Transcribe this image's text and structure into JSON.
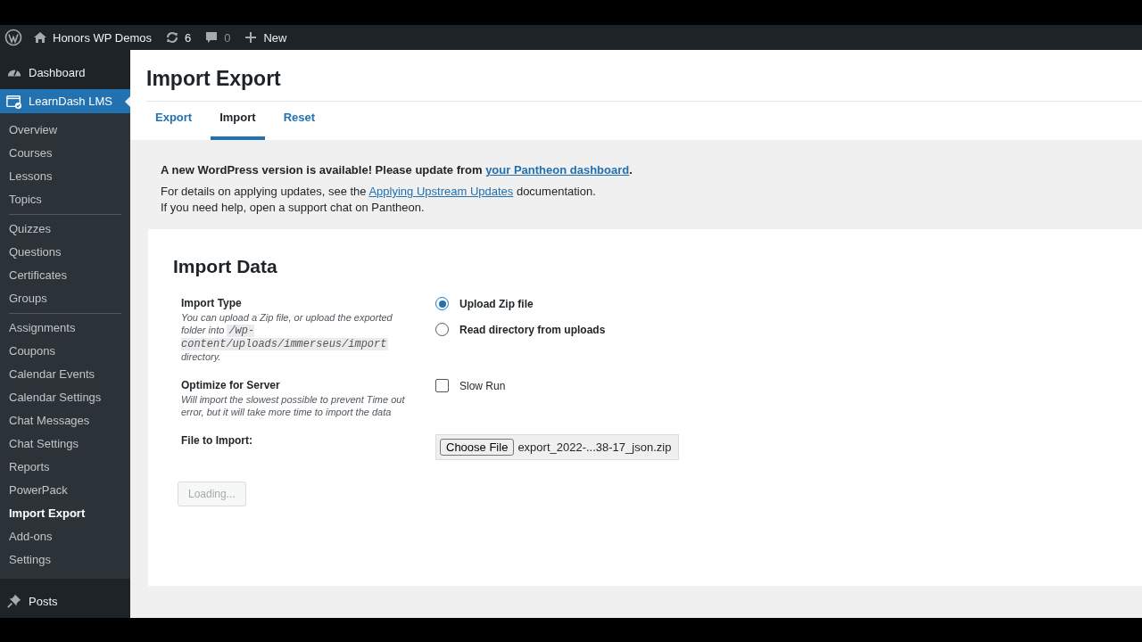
{
  "admin_bar": {
    "site_name": "Honors WP Demos",
    "updates_count": "6",
    "comments_count": "0",
    "new_label": "New"
  },
  "sidebar": {
    "top_items": [
      {
        "label": "Dashboard",
        "selected": false
      },
      {
        "label": "LearnDash LMS",
        "selected": true
      }
    ],
    "submenu_groups": [
      [
        {
          "label": "Overview",
          "selected": false
        },
        {
          "label": "Courses",
          "selected": false
        },
        {
          "label": "Lessons",
          "selected": false
        },
        {
          "label": "Topics",
          "selected": false
        }
      ],
      [
        {
          "label": "Quizzes",
          "selected": false
        },
        {
          "label": "Questions",
          "selected": false
        },
        {
          "label": "Certificates",
          "selected": false
        },
        {
          "label": "Groups",
          "selected": false
        }
      ],
      [
        {
          "label": "Assignments",
          "selected": false
        },
        {
          "label": "Coupons",
          "selected": false
        },
        {
          "label": "Calendar Events",
          "selected": false
        },
        {
          "label": "Calendar Settings",
          "selected": false
        },
        {
          "label": "Chat Messages",
          "selected": false
        },
        {
          "label": "Chat Settings",
          "selected": false
        },
        {
          "label": "Reports",
          "selected": false
        },
        {
          "label": "PowerPack",
          "selected": false
        },
        {
          "label": "Import Export",
          "selected": true
        },
        {
          "label": "Add-ons",
          "selected": false
        },
        {
          "label": "Settings",
          "selected": false
        }
      ]
    ],
    "bottom_items": [
      {
        "label": "Posts",
        "selected": false
      }
    ]
  },
  "page": {
    "title": "Import Export",
    "tabs": [
      {
        "label": "Export",
        "selected": false
      },
      {
        "label": "Import",
        "selected": true
      },
      {
        "label": "Reset",
        "selected": false
      }
    ],
    "notice": {
      "lines": [
        [
          {
            "kind": "text",
            "text": "A new WordPress version is available! Please update from "
          },
          {
            "kind": "link",
            "text": "your Pantheon dashboard"
          },
          {
            "kind": "text",
            "text": "."
          }
        ],
        [
          {
            "kind": "text",
            "text": "For details on applying updates, see the "
          },
          {
            "kind": "link",
            "text": "Applying Upstream Updates"
          },
          {
            "kind": "text",
            "text": " documentation."
          }
        ],
        [
          {
            "kind": "text",
            "text": "If you need help, open a support chat on Pantheon."
          }
        ]
      ]
    },
    "form": {
      "title": "Import Data",
      "rows": [
        {
          "kind": "radio",
          "label": "Import Type",
          "description": [
            {
              "kind": "text",
              "text": "You can upload a Zip file, or upload the exported folder into "
            },
            {
              "kind": "code",
              "text": "/wp-content/uploads/immerseus/import"
            },
            {
              "kind": "text",
              "text": " directory."
            }
          ],
          "options": [
            {
              "label": "Upload Zip file",
              "selected": true
            },
            {
              "label": "Read directory from uploads",
              "selected": false
            }
          ]
        },
        {
          "kind": "checkbox",
          "label": "Optimize for Server",
          "description": [
            {
              "kind": "text",
              "text": "Will import the slowest possible to prevent Time out error, but it will take more time to import the data"
            }
          ],
          "option": {
            "label": "Slow Run",
            "checked": false
          }
        },
        {
          "kind": "file",
          "label": "File to Import:",
          "button_label": "Choose File",
          "file_name": "export_2022-...38-17_json.zip"
        }
      ],
      "submit": {
        "label": "Loading...",
        "disabled": true
      }
    }
  }
}
